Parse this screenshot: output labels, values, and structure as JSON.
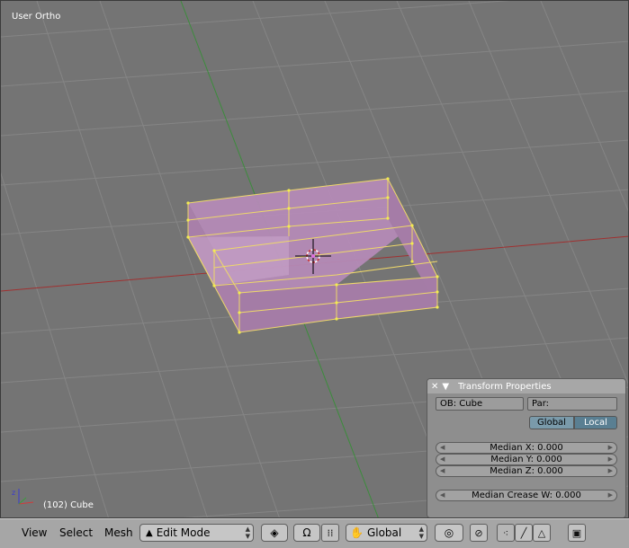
{
  "viewport": {
    "view_name": "User Ortho",
    "object_info": "(102) Cube",
    "axis_x_color": "#b03a3a",
    "axis_y_color": "#3f9a3f",
    "mesh_face_color": "#b68ab8",
    "mesh_edge_color": "#f2e06a"
  },
  "transform_panel": {
    "close_glyph": "✕",
    "collapse_glyph": "▼",
    "title": "Transform Properties",
    "object_field": "OB: Cube",
    "parent_field": "Par:",
    "global_label": "Global",
    "local_label": "Local",
    "median_x": "Median X: 0.000",
    "median_y": "Median Y: 0.000",
    "median_z": "Median Z: 0.000",
    "median_crease": "Median Crease W: 0.000"
  },
  "header": {
    "menu_view": "View",
    "menu_select": "Select",
    "menu_mesh": "Mesh",
    "mode_label": "Edit Mode",
    "orientation_label": "Global",
    "icons": [
      "mode-icon",
      "draw-type-icon",
      "pivot-icon",
      "manipulator-icon",
      "hand-icon",
      "proportional-icon",
      "snap-icon",
      "vertex-select-icon",
      "edge-select-icon",
      "face-select-icon",
      "render-icon"
    ]
  }
}
